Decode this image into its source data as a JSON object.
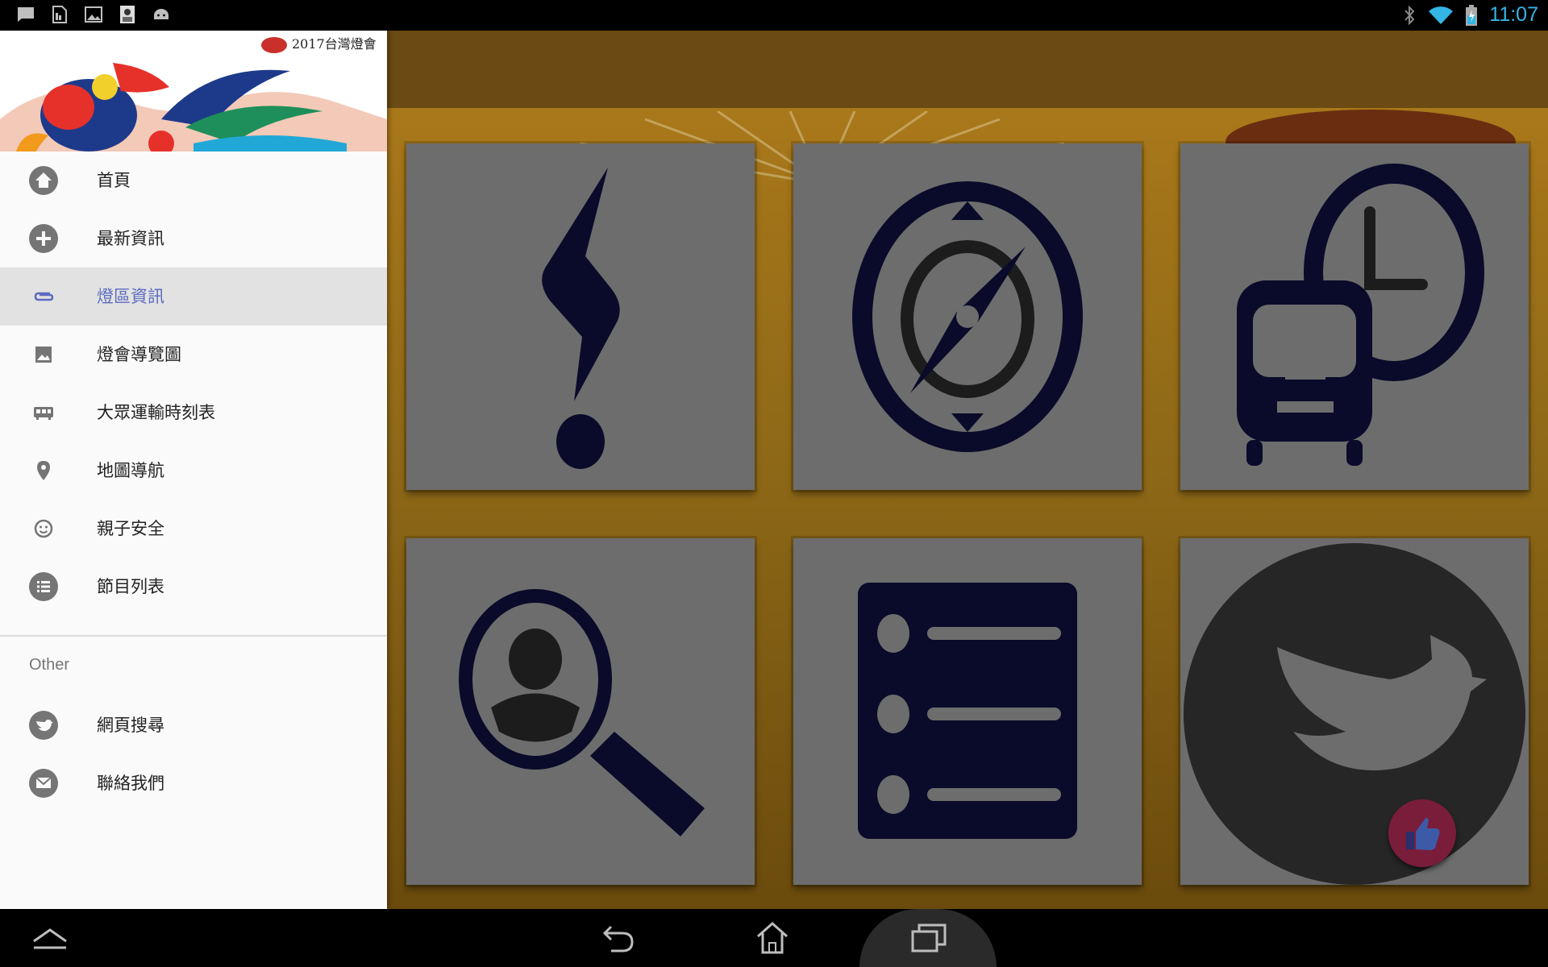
{
  "status_bar": {
    "time": "11:07",
    "left_icons": [
      "message-icon",
      "sim-icon",
      "image-icon",
      "app-thumbnail-icon",
      "android-icon"
    ],
    "right_icons": [
      "bluetooth-icon",
      "wifi-icon",
      "battery-charging-icon"
    ],
    "time_color": "#33b5e5"
  },
  "drawer": {
    "header_logo_text": "2017台灣燈會",
    "items": [
      {
        "label": "首頁",
        "icon": "home-icon",
        "active": false
      },
      {
        "label": "最新資訊",
        "icon": "plus-circle-icon",
        "active": false
      },
      {
        "label": "燈區資訊",
        "icon": "paperclip-icon",
        "active": true
      },
      {
        "label": "燈會導覽圖",
        "icon": "image-icon",
        "active": false
      },
      {
        "label": "大眾運輸時刻表",
        "icon": "bus-icon",
        "active": false
      },
      {
        "label": "地圖導航",
        "icon": "location-pin-icon",
        "active": false
      },
      {
        "label": "親子安全",
        "icon": "smiley-icon",
        "active": false
      },
      {
        "label": "節目列表",
        "icon": "list-icon",
        "active": false
      }
    ],
    "other_header": "Other",
    "other_items": [
      {
        "label": "網頁搜尋",
        "icon": "twitter-icon"
      },
      {
        "label": "聯絡我們",
        "icon": "mail-icon"
      }
    ],
    "active_color": "#5c6bc0"
  },
  "tiles": [
    {
      "icon": "exclamation-icon"
    },
    {
      "icon": "compass-icon"
    },
    {
      "icon": "bus-clock-icon"
    },
    {
      "icon": "person-search-icon"
    },
    {
      "icon": "list-icon"
    },
    {
      "icon": "twitter-bird-icon"
    }
  ],
  "fab": {
    "icon": "thumbs-up-icon"
  },
  "navbar": {
    "buttons": [
      "up-icon",
      "back-icon",
      "home-icon",
      "recents-icon"
    ]
  }
}
